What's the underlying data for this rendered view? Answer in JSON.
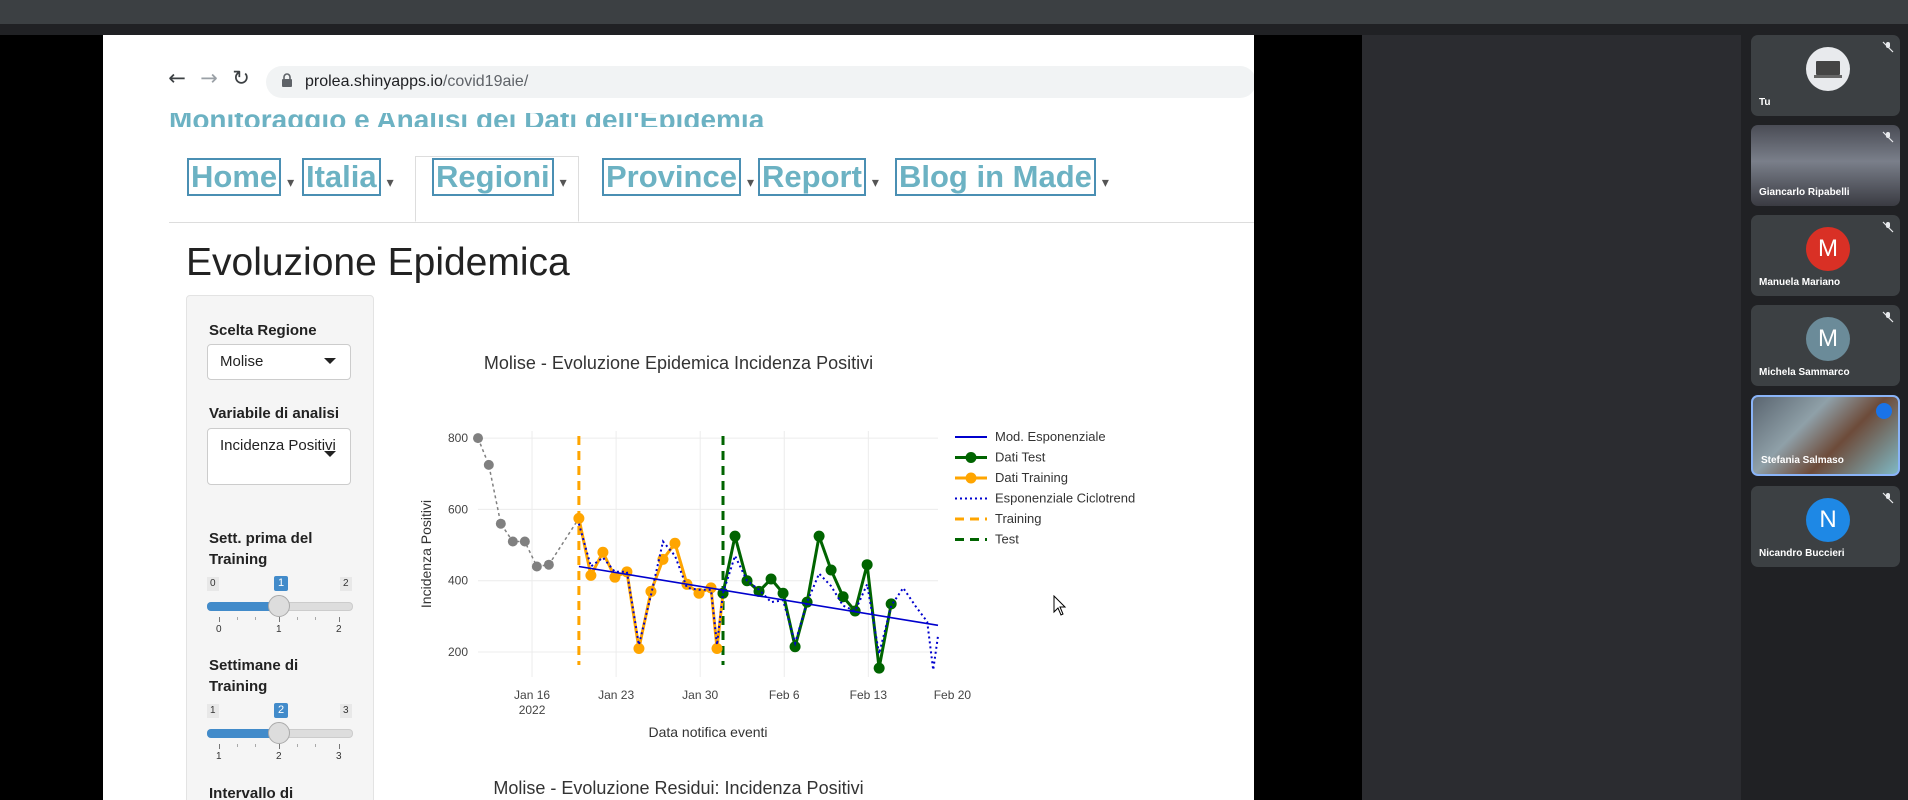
{
  "browser": {
    "url_host": "prolea.shinyapps.io",
    "url_path": "/covid19aie/",
    "header_title": "Monitoraggio e Analisi dei Dati dell'Epidemia"
  },
  "nav": {
    "tabs": [
      {
        "label": "Home"
      },
      {
        "label": "Italia"
      },
      {
        "label": "Regioni"
      },
      {
        "label": "Province"
      },
      {
        "label": "Report"
      },
      {
        "label": "Blog in Made"
      }
    ]
  },
  "page": {
    "title": "Evoluzione Epidemica"
  },
  "sidebar": {
    "region_label": "Scelta Regione",
    "region_value": "Molise",
    "variable_label": "Variabile di analisi",
    "variable_value": "Incidenza Positivi",
    "slider1": {
      "label": "Sett. prima del Training",
      "min": "0",
      "max": "2",
      "value": "1",
      "ticks": [
        "0",
        "1",
        "2"
      ],
      "fraction": 0.5
    },
    "slider2": {
      "label": "Settimane di Training",
      "min": "1",
      "max": "3",
      "value": "2",
      "ticks": [
        "1",
        "2",
        "3"
      ],
      "fraction": 0.5
    },
    "interval_label": "Intervallo di"
  },
  "chart_data": {
    "type": "line",
    "title": "Molise - Evoluzione Epidemica Incidenza Positivi",
    "xlabel": "Data notifica eventi",
    "ylabel": "Incidenza Positivi",
    "x_ticks": [
      "Jan 16\n2022",
      "Jan 23",
      "Jan 30",
      "Feb 6",
      "Feb 13",
      "Feb 20"
    ],
    "y_ticks": [
      200,
      400,
      600,
      800
    ],
    "ylim": [
      130,
      820
    ],
    "xlim_days": [
      11.5,
      49.8
    ],
    "grid": true,
    "legend_position": "right",
    "vlines": [
      {
        "name": "Training",
        "x_day": 19.9,
        "color": "#ffa500"
      },
      {
        "name": "Test",
        "x_day": 31.9,
        "color": "#006400"
      }
    ],
    "series": [
      {
        "name": "Mod. Esponenziale",
        "color": "#0000cd",
        "style": "solid",
        "points": [
          [
            19.9,
            440
          ],
          [
            49.8,
            275
          ]
        ]
      },
      {
        "name": "Dati Test",
        "color": "#006400",
        "style": "marker-line",
        "points": [
          [
            31.9,
            365
          ],
          [
            32.9,
            525
          ],
          [
            33.9,
            400
          ],
          [
            34.9,
            370
          ],
          [
            35.9,
            405
          ],
          [
            36.9,
            365
          ],
          [
            37.9,
            215
          ],
          [
            38.9,
            340
          ],
          [
            39.9,
            525
          ],
          [
            40.9,
            430
          ],
          [
            41.9,
            355
          ],
          [
            42.9,
            315
          ],
          [
            43.9,
            445
          ],
          [
            44.9,
            155
          ],
          [
            45.9,
            335
          ]
        ]
      },
      {
        "name": "Dati Training",
        "color": "#ffa500",
        "style": "marker-line",
        "points": [
          [
            19.9,
            575
          ],
          [
            20.9,
            415
          ],
          [
            21.9,
            480
          ],
          [
            22.9,
            410
          ],
          [
            23.9,
            425
          ],
          [
            24.9,
            210
          ],
          [
            25.9,
            370
          ],
          [
            26.9,
            460
          ],
          [
            27.9,
            505
          ],
          [
            28.9,
            390
          ],
          [
            29.9,
            365
          ],
          [
            30.9,
            380
          ],
          [
            31.4,
            210
          ],
          [
            31.9,
            365
          ]
        ]
      },
      {
        "name": "Esponenziale Ciclotrend",
        "color": "#0000cd",
        "style": "dotted",
        "points": [
          [
            19.9,
            560
          ],
          [
            20.9,
            440
          ],
          [
            21.9,
            465
          ],
          [
            22.9,
            425
          ],
          [
            23.9,
            425
          ],
          [
            24.9,
            220
          ],
          [
            25.9,
            360
          ],
          [
            26.9,
            510
          ],
          [
            27.9,
            470
          ],
          [
            28.9,
            380
          ],
          [
            29.9,
            375
          ],
          [
            30.9,
            375
          ],
          [
            31.4,
            220
          ],
          [
            31.9,
            365
          ],
          [
            32.9,
            470
          ],
          [
            33.9,
            400
          ],
          [
            34.9,
            375
          ],
          [
            35.9,
            340
          ],
          [
            36.9,
            345
          ],
          [
            37.9,
            225
          ],
          [
            38.9,
            340
          ],
          [
            39.9,
            420
          ],
          [
            40.9,
            385
          ],
          [
            41.9,
            330
          ],
          [
            42.9,
            315
          ],
          [
            43.9,
            390
          ],
          [
            44.9,
            195
          ],
          [
            45.9,
            330
          ],
          [
            46.9,
            380
          ],
          [
            47.9,
            330
          ],
          [
            48.9,
            285
          ],
          [
            49.4,
            150
          ],
          [
            49.8,
            245
          ]
        ]
      },
      {
        "name": "Pre-training",
        "color": "#808080",
        "style": "dotted-marker",
        "legend": false,
        "points": [
          [
            11.5,
            800
          ],
          [
            12.4,
            725
          ],
          [
            13.4,
            560
          ],
          [
            14.4,
            510
          ],
          [
            15.4,
            510
          ],
          [
            16.4,
            440
          ],
          [
            17.4,
            445
          ],
          [
            19.9,
            575
          ]
        ]
      }
    ]
  },
  "chart2": {
    "title": "Molise - Evoluzione Residui: Incidenza Positivi"
  },
  "participants": [
    {
      "name": "Tu",
      "kind": "photo-device"
    },
    {
      "name": "Giancarlo Ripabelli",
      "kind": "photo-room"
    },
    {
      "name": "Manuela Mariano",
      "initial": "M",
      "color": "#d93025"
    },
    {
      "name": "Michela Sammarco",
      "initial": "M",
      "color": "#6b8b99"
    },
    {
      "name": "Stefania Salmaso",
      "kind": "photo-person"
    },
    {
      "name": "Nicandro Buccieri",
      "initial": "N",
      "color": "#1e88e5"
    }
  ],
  "colors": {
    "accent": "#6cb2c3",
    "slider": "#428bca"
  },
  "icons": [
    "back-arrow-icon",
    "forward-arrow-icon",
    "reload-icon",
    "lock-icon",
    "mic-off-icon",
    "cursor-icon"
  ]
}
